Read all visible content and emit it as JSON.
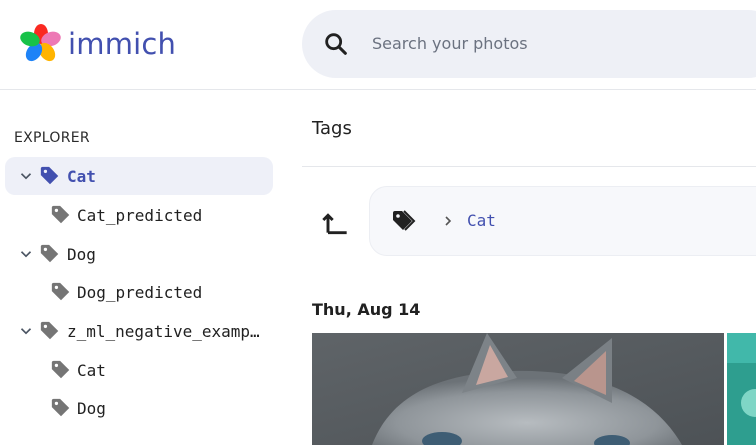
{
  "header": {
    "logo_text": "immich",
    "search_placeholder": "Search your photos"
  },
  "sidebar": {
    "section_title": "EXPLORER",
    "items": [
      {
        "label": "Cat",
        "active": true,
        "expanded": true,
        "level": 0
      },
      {
        "label": "Cat_predicted",
        "active": false,
        "level": 1
      },
      {
        "label": "Dog",
        "active": false,
        "expanded": true,
        "level": 0
      },
      {
        "label": "Dog_predicted",
        "active": false,
        "level": 1
      },
      {
        "label": "z_ml_negative_examples",
        "active": false,
        "expanded": true,
        "level": 0
      },
      {
        "label": "Cat",
        "active": false,
        "level": 1
      },
      {
        "label": "Dog",
        "active": false,
        "level": 1
      }
    ]
  },
  "main": {
    "title": "Tags",
    "breadcrumb": {
      "current": "Cat"
    },
    "date_group": "Thu, Aug 14"
  },
  "colors": {
    "accent": "#4250af",
    "active_bg": "#eef0f8",
    "search_bg": "#eef0f6"
  }
}
